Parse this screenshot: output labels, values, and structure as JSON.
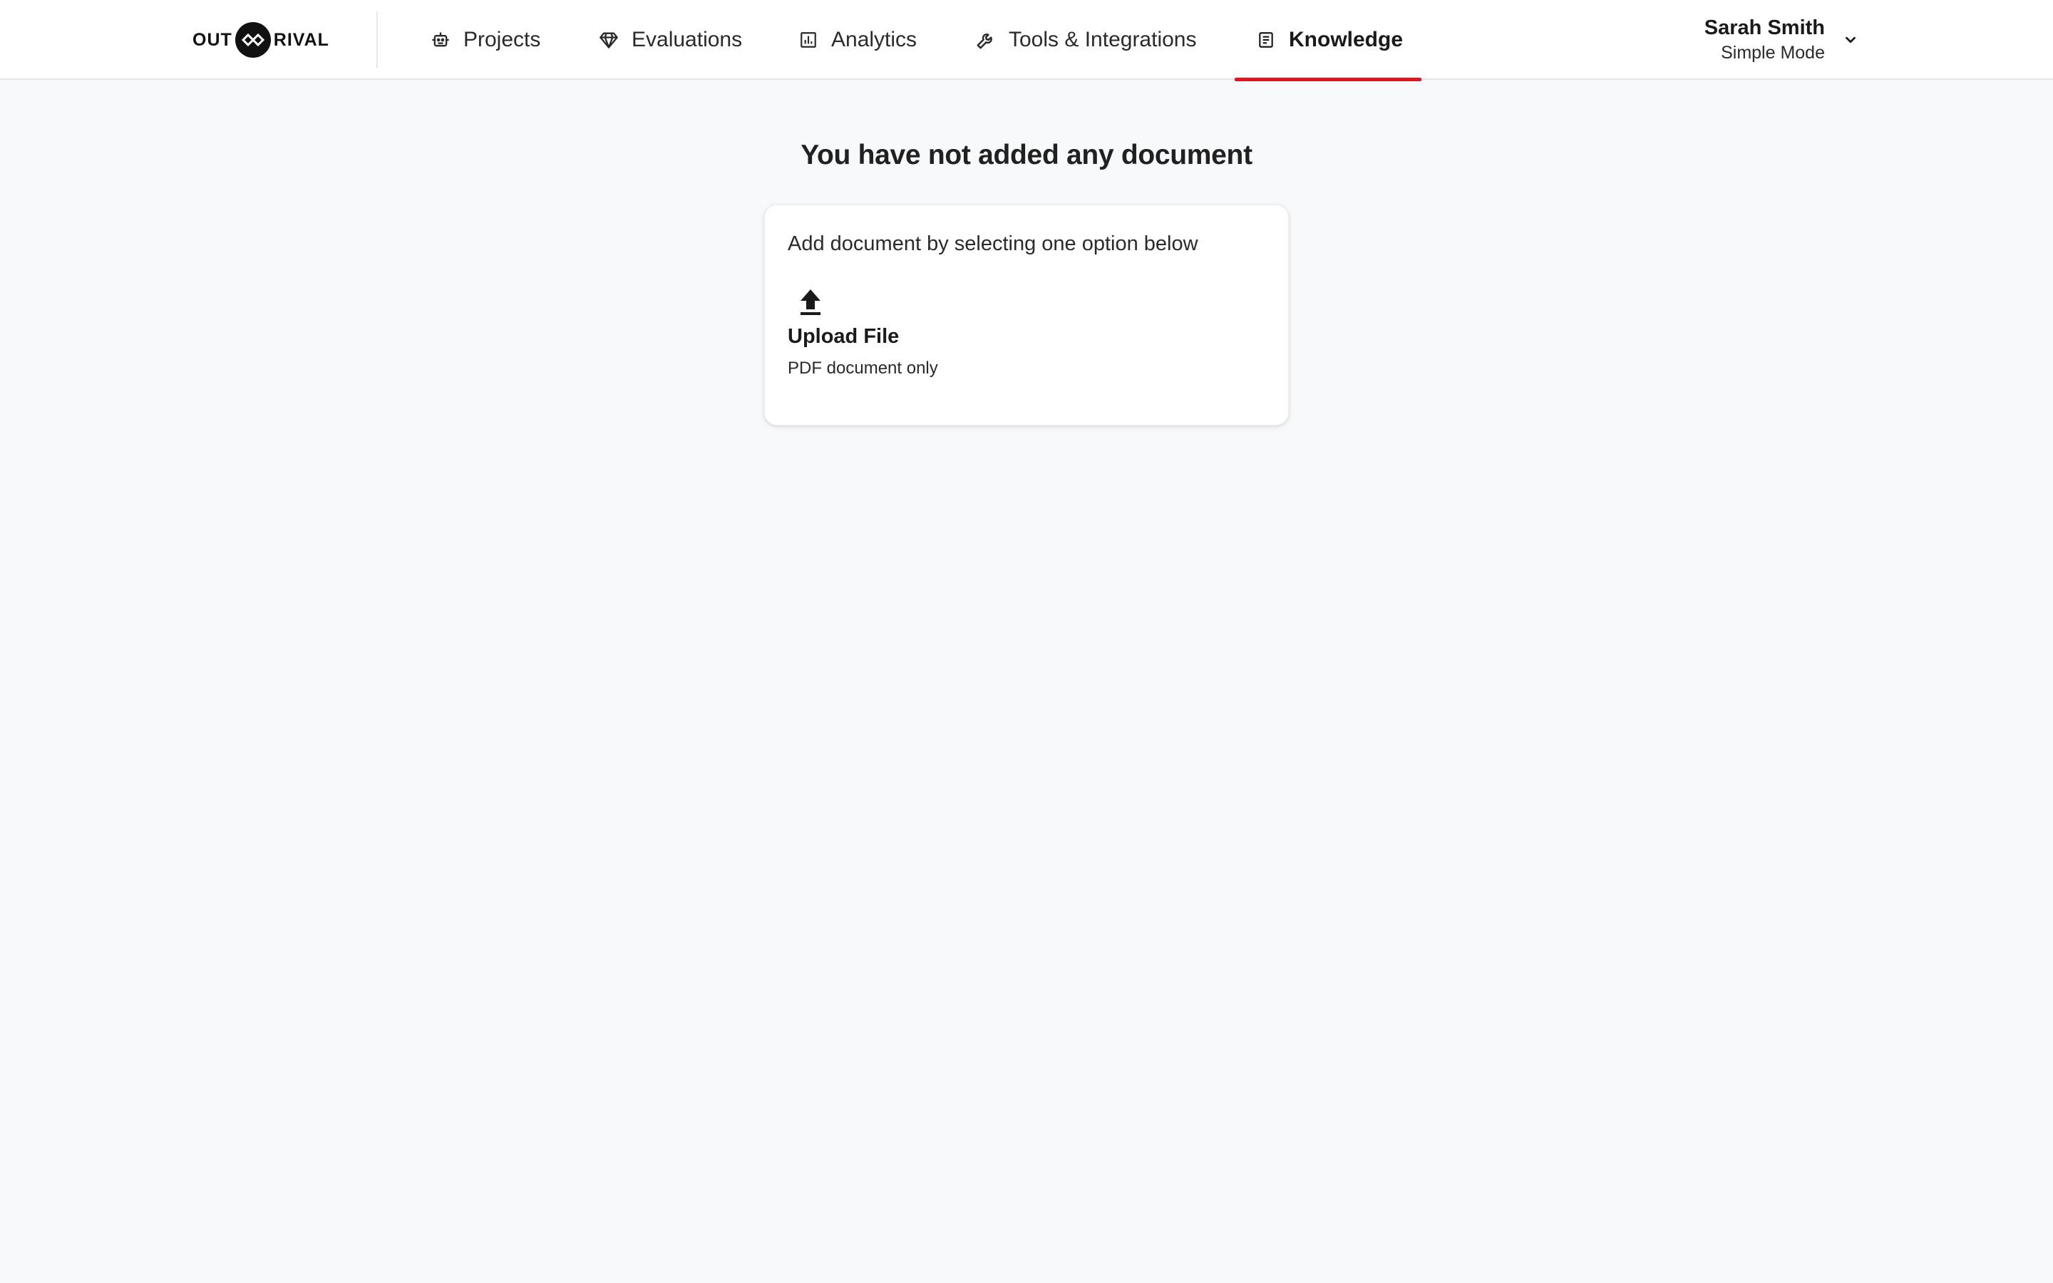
{
  "header": {
    "logo": {
      "left_text": "OUT",
      "right_text": "RIVAL"
    },
    "nav": [
      {
        "label": "Projects",
        "icon": "robot-icon",
        "active": false
      },
      {
        "label": "Evaluations",
        "icon": "diamond-icon",
        "active": false
      },
      {
        "label": "Analytics",
        "icon": "chart-icon",
        "active": false
      },
      {
        "label": "Tools & Integrations",
        "icon": "wrench-icon",
        "active": false
      },
      {
        "label": "Knowledge",
        "icon": "document-icon",
        "active": true
      }
    ],
    "user": {
      "name": "Sarah Smith",
      "mode": "Simple Mode",
      "menu_icon": "chevron-down-icon"
    }
  },
  "main": {
    "empty_title": "You have not added any document",
    "card": {
      "subtitle": "Add document by selecting one option below",
      "options": [
        {
          "icon": "upload-icon",
          "title": "Upload File",
          "description": "PDF document only"
        }
      ]
    }
  },
  "colors": {
    "accent": "#e0161f",
    "background": "#f8f9fa",
    "header_bg": "#ffffff",
    "text": "#212121"
  }
}
